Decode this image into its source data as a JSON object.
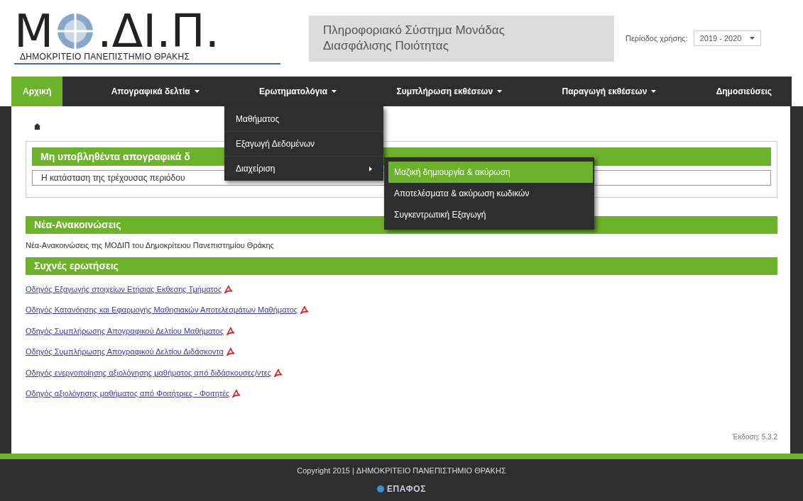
{
  "logo": {
    "letter_left": "Μ",
    "letters_right": ".ΔΙ.Π.",
    "subtitle": "ΔΗΜΟΚΡΙΤΕΙΟ ΠΑΝΕΠΙΣΤΗΜΙΟ ΘΡΑΚΗΣ"
  },
  "system_title": "Πληροφοριακό Σύστημα Μονάδας Διασφάλισης Ποιότητας",
  "period": {
    "label": "Περίοδος χρήσης:",
    "value": "2019 - 2020"
  },
  "nav": [
    {
      "label": "Αρχική",
      "selected": true,
      "dropdown": false
    },
    {
      "label": "Απογραφικά δελτία",
      "selected": false,
      "dropdown": true
    },
    {
      "label": "Ερωτηματολόγια",
      "selected": false,
      "dropdown": true
    },
    {
      "label": "Συμπλήρωση εκθέσεων",
      "selected": false,
      "dropdown": true
    },
    {
      "label": "Παραγωγή εκθέσεων",
      "selected": false,
      "dropdown": true
    },
    {
      "label": "Δημοσιεύσεις",
      "selected": false,
      "dropdown": false
    }
  ],
  "menu": [
    {
      "label": "Μαθήματος",
      "submenu": false
    },
    {
      "label": "Εξαγωγή Δεδομένων",
      "submenu": false
    },
    {
      "label": "Διαχείριση",
      "submenu": true
    }
  ],
  "submenu": [
    {
      "label": "Μαζική δημιουργία & ακύρωση",
      "selected": true
    },
    {
      "label": "Αποτελέσματα & ακύρωση κωδικών",
      "selected": false
    },
    {
      "label": "Συγκεντρωτική Εξαγωγή",
      "selected": false
    }
  ],
  "panel": {
    "title": "Μη υποβληθέντα απογραφικά δ",
    "message": "Η κατάσταση της τρέχουσας περιόδου"
  },
  "news": {
    "title": "Νέα-Ανακοινώσεις",
    "text": "Νέα-Ανακοινώσεις της ΜΟΔΙΠ του Δημοκρίτειου Πανεπιστημίου Θράκης"
  },
  "faq": {
    "title": "Συχνές ερωτήσεις",
    "links": [
      "Οδηγός Εξαγωγής στοιχείων Ετήσιας Εκθεσης Τμήματος",
      "Οδηγός Κατανόησης και Εφαρμογής Μαθησιακών Αποτελεσμάτων Μαθήματος",
      "Οδηγός Συμπλήρωσης Απογραφικού Δελτίου Μαθήματος",
      "Οδηγός Συμπλήρωσης Απογραφικού Δελτίου Διδάσκοντα",
      "Οδηγός ενεργοποίησης αξιολόγησης μαθήματος από διδάσκουσες/ντες",
      "Οδηγός αξιολόγησης μαθήματος από Φοιτήτριες - Φοιτητές"
    ]
  },
  "version": "Έκδοση: 5.3.2",
  "footer": {
    "copyright": "Copyright 2015 | ΔΗΜΟΚΡΙΤΕΙΟ ΠΑΝΕΠΙΣΤΗΜΙΟ ΘΡΑΚΗΣ",
    "brand": "ΕΠΑΦΟΣ"
  }
}
